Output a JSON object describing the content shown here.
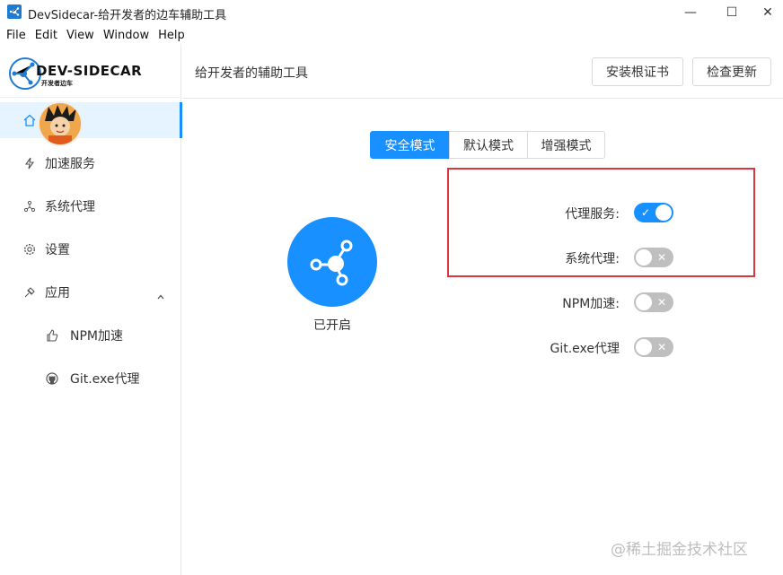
{
  "window": {
    "title": "DevSidecar-给开发者的边车辅助工具",
    "controls": {
      "minimize": "—",
      "maximize": "☐",
      "close": "✕"
    }
  },
  "menu": [
    "File",
    "Edit",
    "View",
    "Window",
    "Help"
  ],
  "logo": {
    "text": "DEV-SIDECAR",
    "subtitle": "开发者边车"
  },
  "sidebar": {
    "items": [
      {
        "label": "",
        "icon": "home-icon"
      },
      {
        "label": "加速服务",
        "icon": "bolt-icon"
      },
      {
        "label": "系统代理",
        "icon": "nodes-icon"
      },
      {
        "label": "设置",
        "icon": "gear-icon"
      },
      {
        "label": "应用",
        "icon": "app-icon"
      },
      {
        "label": "NPM加速",
        "icon": "thumbs-up-icon"
      },
      {
        "label": "Git.exe代理",
        "icon": "github-icon"
      }
    ]
  },
  "header": {
    "title": "给开发者的辅助工具",
    "install_cert": "安装根证书",
    "check_update": "检查更新"
  },
  "modes": {
    "tabs": [
      "安全模式",
      "默认模式",
      "增强模式"
    ],
    "active": "安全模式"
  },
  "status": {
    "text": "已开启"
  },
  "switches": [
    {
      "label": "代理服务:",
      "on": true,
      "mark": "✓"
    },
    {
      "label": "系统代理:",
      "on": false,
      "mark": "✕"
    },
    {
      "label": "NPM加速:",
      "on": false,
      "mark": "✕"
    },
    {
      "label": "Git.exe代理",
      "on": false,
      "mark": "✕"
    }
  ],
  "watermark": "@稀土掘金技术社区",
  "colors": {
    "accent": "#1890ff",
    "highlight_border": "#d9363e"
  }
}
